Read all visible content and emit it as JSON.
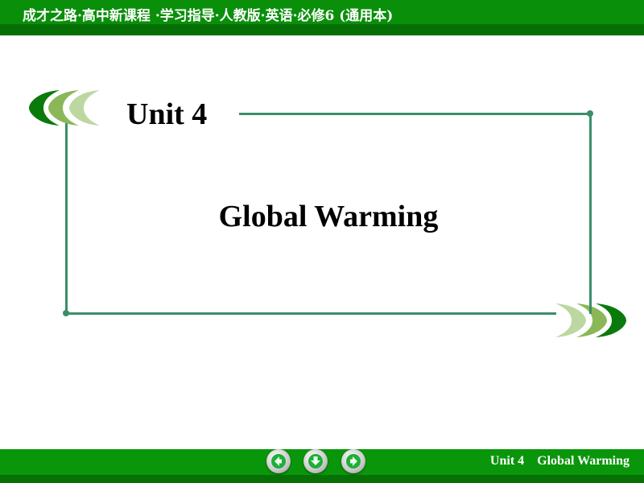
{
  "header": {
    "title": "成才之路·高中新课程 ·学习指导·人教版·英语·必修6 (通用本)"
  },
  "slide": {
    "unit_label": "Unit 4",
    "title": "Global Warming"
  },
  "footer": {
    "unit": "Unit 4",
    "title": "Global Warming",
    "nav": {
      "back_icon": "arrow-left-icon",
      "home_icon": "arrow-down-icon",
      "next_icon": "arrow-right-icon"
    }
  },
  "colors": {
    "bar_green": "#0a960a",
    "bar_dark_green": "#067006",
    "frame_line": "#3a8f6a",
    "leaf_dark": "#0a7a0a",
    "leaf_mid": "#8ab858",
    "leaf_light": "#bcd8a0"
  }
}
